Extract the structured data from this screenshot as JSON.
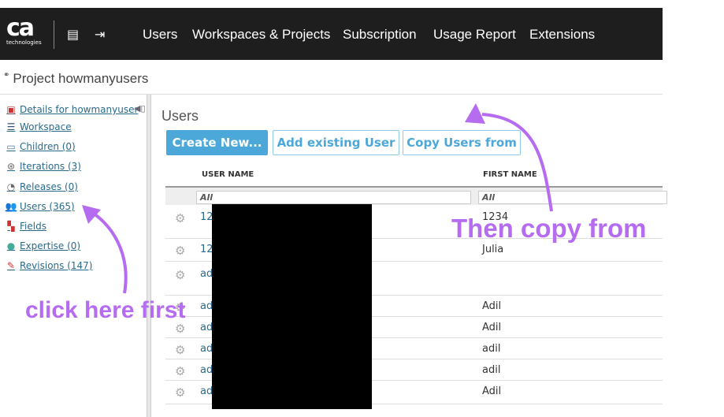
{
  "topbar": {
    "logo_text": "ca",
    "logo_subtext": "technologies",
    "nav": [
      "Users",
      "Workspaces & Projects",
      "Subscription",
      "Usage Report",
      "Extensions"
    ]
  },
  "project": {
    "title": "Project howmanyusers"
  },
  "sidebar": {
    "items": [
      {
        "label": "Details for howmanyuser",
        "icon": "details-icon"
      },
      {
        "label": "Workspace",
        "icon": "workspace-icon"
      },
      {
        "label": "Children (0)",
        "icon": "folder-icon"
      },
      {
        "label": "Iterations (3)",
        "icon": "iterations-icon"
      },
      {
        "label": "Releases (0)",
        "icon": "releases-icon"
      },
      {
        "label": "Users (365)",
        "icon": "users-icon"
      },
      {
        "label": "Fields",
        "icon": "fields-icon"
      },
      {
        "label": "Expertise (0)",
        "icon": "expertise-icon"
      },
      {
        "label": "Revisions (147)",
        "icon": "revisions-icon"
      }
    ]
  },
  "main": {
    "title": "Users",
    "buttons": {
      "create": "Create New...",
      "add_existing": "Add existing User",
      "copy": "Copy Users from"
    },
    "columns": [
      "USER NAME",
      "FIRST NAME"
    ],
    "filters": [
      "All",
      "All"
    ],
    "rows": [
      {
        "user": "12",
        "first": "1234"
      },
      {
        "user": "12",
        "first": "Julia"
      },
      {
        "user": "ad",
        "first": ""
      },
      {
        "user": "ad",
        "first": "Adil"
      },
      {
        "user": "ad",
        "first": "Adil"
      },
      {
        "user": "ad",
        "first": "adil"
      },
      {
        "user": "ad",
        "first": "adil"
      },
      {
        "user": "ad",
        "first": "Adil"
      }
    ]
  },
  "annotations": {
    "first": "click here first",
    "second": "Then copy from"
  },
  "colors": {
    "accent": "#4ba8d8",
    "annotation": "#b56cf0",
    "link": "#2a6a8a"
  }
}
